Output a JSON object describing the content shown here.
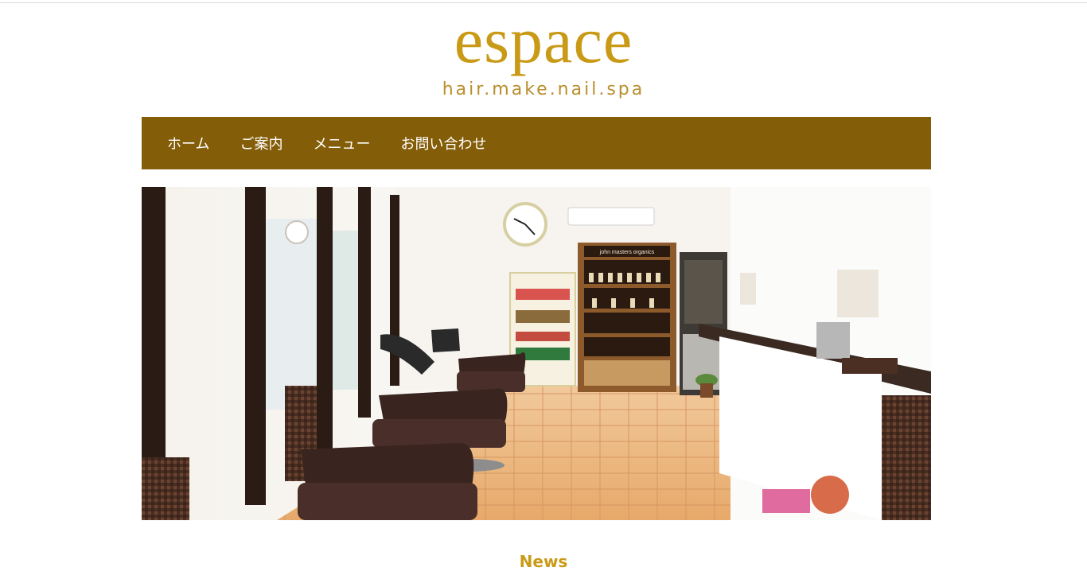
{
  "logo": {
    "name": "espace",
    "tagline": "hair.make.nail.spa"
  },
  "nav": {
    "items": [
      {
        "label": "ホーム"
      },
      {
        "label": "ご案内"
      },
      {
        "label": "メニュー"
      },
      {
        "label": "お問い合わせ"
      }
    ]
  },
  "hero": {
    "shelf_sign": "john masters organics"
  },
  "news": {
    "heading": "News"
  },
  "colors": {
    "brand_gold": "#c99a16",
    "nav_brown": "#845d08"
  }
}
